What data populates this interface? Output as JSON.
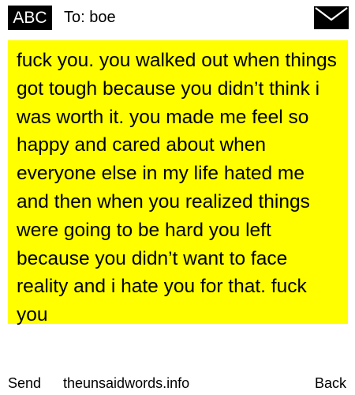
{
  "header": {
    "badge_label": "ABC",
    "to_prefix": "To:",
    "recipient": "boe",
    "envelope_icon": "envelope-icon"
  },
  "message": {
    "body": "fuck you. you walked out when things got tough because you didn’t think i was worth it. you made me feel so happy and cared about when everyone else in my life hated me and then when you realized things were going to be hard you left because you didn’t want to face reality and i hate you for that. fuck you",
    "background_color": "#ffff00"
  },
  "footer": {
    "send_label": "Send",
    "site_label": "theunsaidwords.info",
    "back_label": "Back"
  }
}
